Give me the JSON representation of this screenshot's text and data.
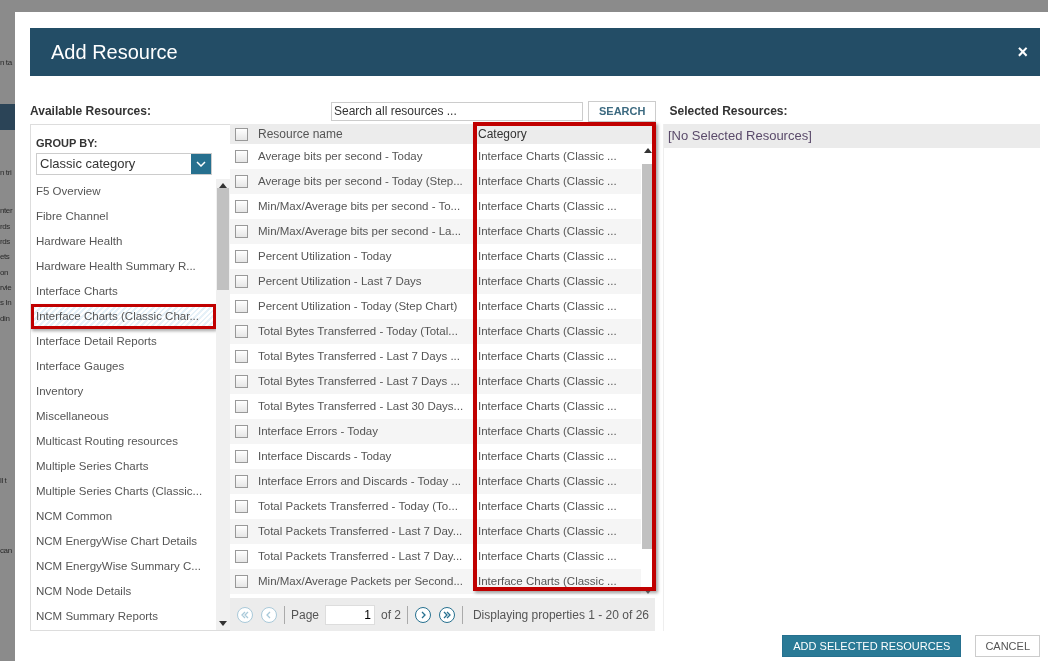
{
  "background_fragments": [
    "n ta",
    "n tri",
    "nter",
    "rds",
    "rds",
    "ets",
    "on",
    "rvie",
    "s In",
    "din",
    "ll t",
    "can"
  ],
  "dialog": {
    "title": "Add Resource",
    "close": "×"
  },
  "available": {
    "label": "Available Resources:",
    "group_by_label": "GROUP BY:",
    "group_by_value": "Classic category",
    "groups": [
      {
        "label": "F5 Overview",
        "selected": false,
        "highlighted": false
      },
      {
        "label": "Fibre Channel",
        "selected": false,
        "highlighted": false
      },
      {
        "label": "Hardware Health",
        "selected": false,
        "highlighted": false
      },
      {
        "label": "Hardware Health Summary R...",
        "selected": false,
        "highlighted": false
      },
      {
        "label": "Interface Charts",
        "selected": false,
        "highlighted": false
      },
      {
        "label": "Interface Charts (Classic Char...",
        "selected": true,
        "highlighted": true
      },
      {
        "label": "Interface Detail Reports",
        "selected": false,
        "highlighted": false
      },
      {
        "label": "Interface Gauges",
        "selected": false,
        "highlighted": false
      },
      {
        "label": "Inventory",
        "selected": false,
        "highlighted": false
      },
      {
        "label": "Miscellaneous",
        "selected": false,
        "highlighted": false
      },
      {
        "label": "Multicast Routing resources",
        "selected": false,
        "highlighted": false
      },
      {
        "label": "Multiple Series Charts",
        "selected": false,
        "highlighted": false
      },
      {
        "label": "Multiple Series Charts (Classic...",
        "selected": false,
        "highlighted": false
      },
      {
        "label": "NCM Common",
        "selected": false,
        "highlighted": false
      },
      {
        "label": "NCM EnergyWise Chart Details",
        "selected": false,
        "highlighted": false
      },
      {
        "label": "NCM EnergyWise Summary C...",
        "selected": false,
        "highlighted": false
      },
      {
        "label": "NCM Node Details",
        "selected": false,
        "highlighted": false
      },
      {
        "label": "NCM Summary Reports",
        "selected": false,
        "highlighted": false
      }
    ]
  },
  "search": {
    "placeholder": "Search all resources ...",
    "button": "SEARCH"
  },
  "grid": {
    "select_all_checked": false,
    "columns": [
      {
        "label": "Resource name",
        "highlighted": false
      },
      {
        "label": "Category",
        "highlighted": true
      }
    ],
    "rows": [
      {
        "name": "Average bits per second - Today",
        "category": "Interface Charts (Classic ...",
        "checked": false
      },
      {
        "name": "Average bits per second - Today (Step...",
        "category": "Interface Charts (Classic ...",
        "checked": false
      },
      {
        "name": "Min/Max/Average bits per second - To...",
        "category": "Interface Charts (Classic ...",
        "checked": false
      },
      {
        "name": "Min/Max/Average bits per second - La...",
        "category": "Interface Charts (Classic ...",
        "checked": false
      },
      {
        "name": "Percent Utilization - Today",
        "category": "Interface Charts (Classic ...",
        "checked": false
      },
      {
        "name": "Percent Utilization - Last 7 Days",
        "category": "Interface Charts (Classic ...",
        "checked": false
      },
      {
        "name": "Percent Utilization - Today (Step Chart)",
        "category": "Interface Charts (Classic ...",
        "checked": false
      },
      {
        "name": "Total Bytes Transferred - Today (Total...",
        "category": "Interface Charts (Classic ...",
        "checked": false
      },
      {
        "name": "Total Bytes Transferred - Last 7 Days ...",
        "category": "Interface Charts (Classic ...",
        "checked": false
      },
      {
        "name": "Total Bytes Transferred - Last 7 Days ...",
        "category": "Interface Charts (Classic ...",
        "checked": false
      },
      {
        "name": "Total Bytes Transferred - Last 30 Days...",
        "category": "Interface Charts (Classic ...",
        "checked": false
      },
      {
        "name": "Interface Errors - Today",
        "category": "Interface Charts (Classic ...",
        "checked": false
      },
      {
        "name": "Interface Discards - Today",
        "category": "Interface Charts (Classic ...",
        "checked": false
      },
      {
        "name": "Interface Errors and Discards - Today ...",
        "category": "Interface Charts (Classic ...",
        "checked": false
      },
      {
        "name": "Total Packets Transferred - Today (To...",
        "category": "Interface Charts (Classic ...",
        "checked": false
      },
      {
        "name": "Total Packets Transferred - Last 7 Day...",
        "category": "Interface Charts (Classic ...",
        "checked": false
      },
      {
        "name": "Total Packets Transferred - Last 7 Day...",
        "category": "Interface Charts (Classic ...",
        "checked": false
      },
      {
        "name": "Min/Max/Average Packets per Second...",
        "category": "Interface Charts (Classic ...",
        "checked": false
      }
    ],
    "pager": {
      "nav": [
        {
          "kind": "first",
          "disabled": true
        },
        {
          "kind": "prev",
          "disabled": true
        },
        {
          "kind": "next",
          "disabled": false
        },
        {
          "kind": "last",
          "disabled": false
        }
      ],
      "page_label": "Page",
      "page": "1",
      "of": "of 2",
      "summary": "Displaying properties 1 - 20 of 26"
    }
  },
  "selected": {
    "label": "Selected Resources:",
    "empty": "[No Selected Resources]"
  },
  "buttons": [
    {
      "label": "ADD SELECTED RESOURCES",
      "kind": "primary"
    },
    {
      "label": "CANCEL",
      "kind": "secondary"
    }
  ]
}
